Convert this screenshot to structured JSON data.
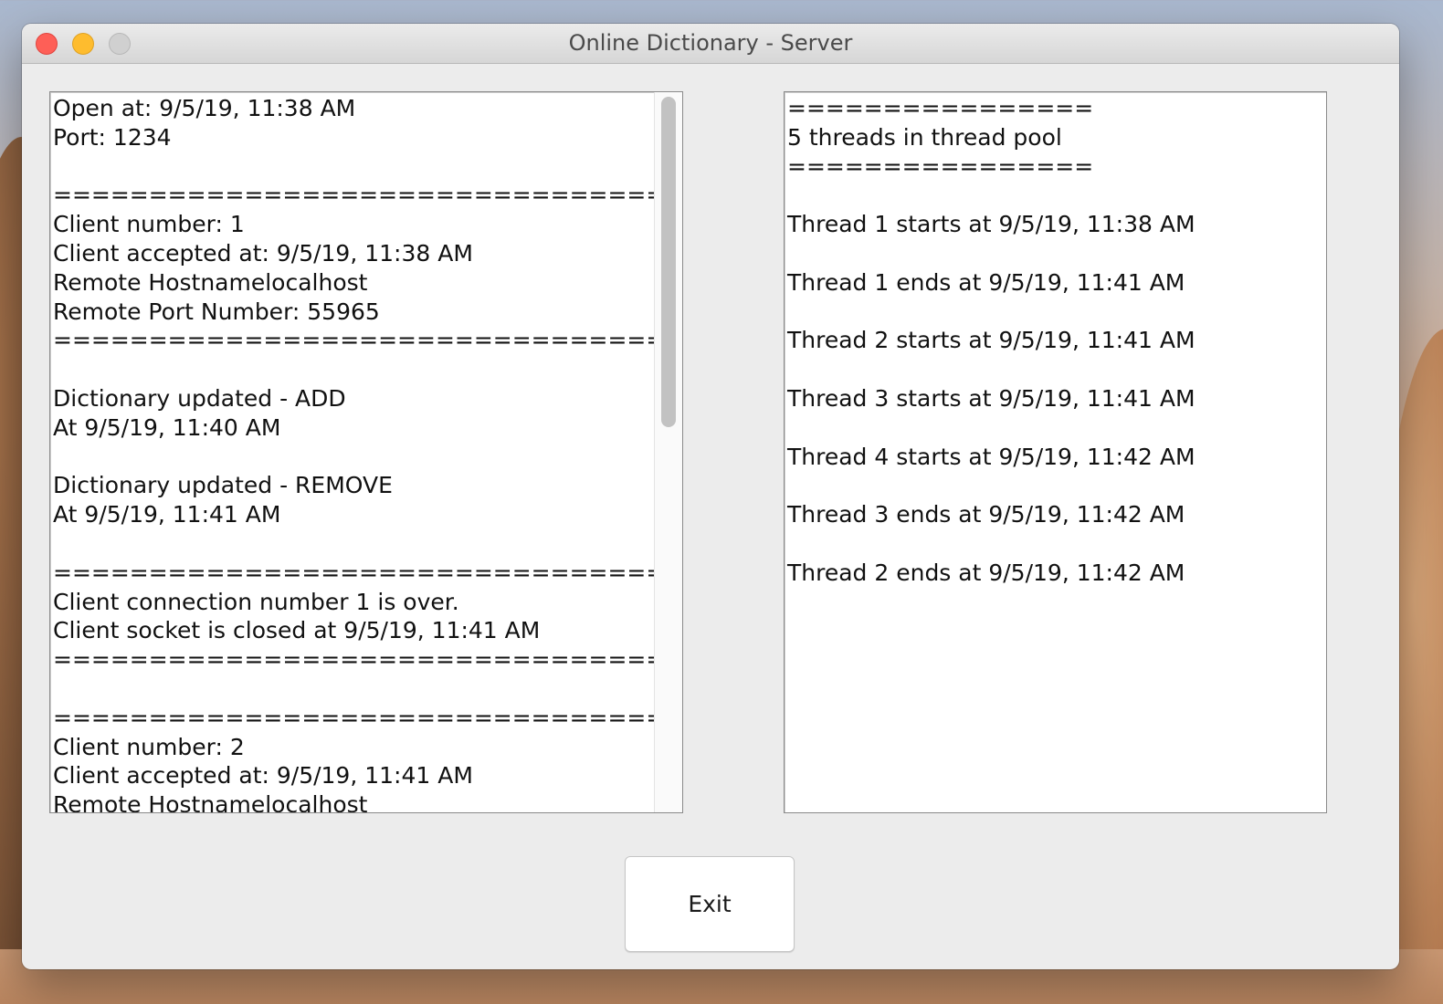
{
  "window": {
    "title": "Online Dictionary - Server"
  },
  "server_log": {
    "text": "Open at: 9/5/19, 11:38 AM\nPort: 1234\n\n================================\nClient number: 1\nClient accepted at: 9/5/19, 11:38 AM\nRemote Hostnamelocalhost\nRemote Port Number: 55965\n================================\n\nDictionary updated - ADD\nAt 9/5/19, 11:40 AM\n\nDictionary updated - REMOVE\nAt 9/5/19, 11:41 AM\n\n================================\nClient connection number 1 is over.\nClient socket is closed at 9/5/19, 11:41 AM\n================================\n\n================================\nClient number: 2\nClient accepted at: 9/5/19, 11:41 AM\nRemote Hostnamelocalhost"
  },
  "thread_log": {
    "text": "================\n5 threads in thread pool\n================\n\nThread 1 starts at 9/5/19, 11:38 AM\n\nThread 1 ends at 9/5/19, 11:41 AM\n\nThread 2 starts at 9/5/19, 11:41 AM\n\nThread 3 starts at 9/5/19, 11:41 AM\n\nThread 4 starts at 9/5/19, 11:42 AM\n\nThread 3 ends at 9/5/19, 11:42 AM\n\nThread 2 ends at 9/5/19, 11:42 AM"
  },
  "buttons": {
    "exit_label": "Exit"
  },
  "colors": {
    "close": "#fe5f57",
    "minimize": "#febc2e",
    "maximize_disabled": "#d0d0d0",
    "window_bg": "#ececec"
  }
}
